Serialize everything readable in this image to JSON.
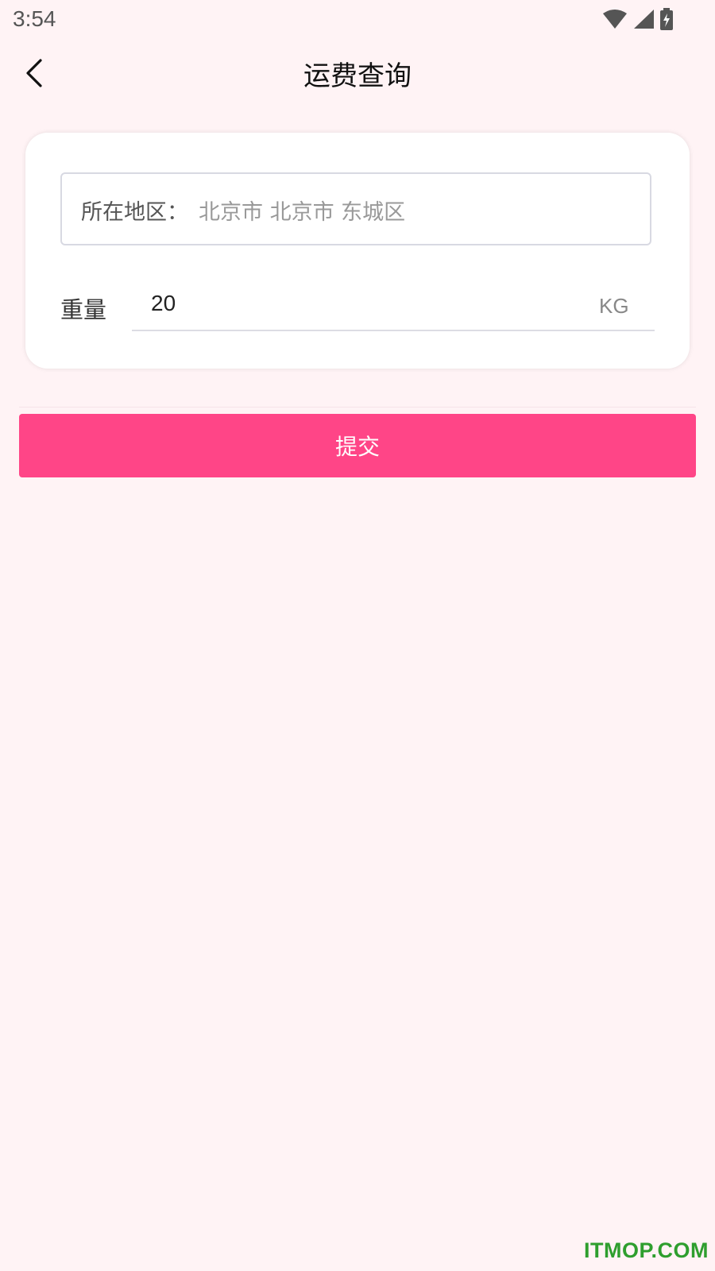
{
  "status_bar": {
    "time": "3:54",
    "icons": [
      "wifi-icon",
      "signal-icon",
      "battery-charging-icon"
    ]
  },
  "header": {
    "title": "运费查询",
    "back_icon": "chevron-left-icon"
  },
  "form": {
    "region_label": "所在地区：",
    "region_value": "北京市 北京市 东城区",
    "weight_label": "重量",
    "weight_value": "20",
    "weight_unit": "KG"
  },
  "submit_label": "提交",
  "watermark": "ITMOP.COM",
  "colors": {
    "background": "#fff3f5",
    "accent": "#ff4587",
    "watermark": "#2e9e2e"
  }
}
